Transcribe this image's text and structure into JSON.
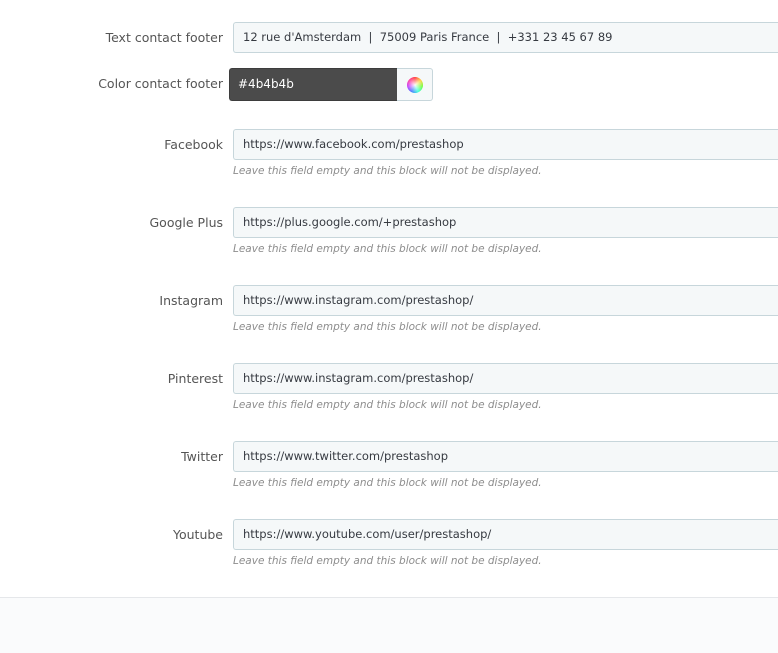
{
  "contact": {
    "text_label": "Text contact footer",
    "text_value": "12 rue d'Amsterdam  |  75009 Paris France  |  +331 23 45 67 89",
    "color_label": "Color contact footer",
    "color_value": "#4b4b4b",
    "color_picker_icon": "color-wheel-icon"
  },
  "social": [
    {
      "label": "Facebook",
      "value": "https://www.facebook.com/prestashop",
      "help": "Leave this field empty and this block will not be displayed."
    },
    {
      "label": "Google Plus",
      "value": "https://plus.google.com/+prestashop",
      "help": "Leave this field empty and this block will not be displayed."
    },
    {
      "label": "Instagram",
      "value": "https://www.instagram.com/prestashop/",
      "help": "Leave this field empty and this block will not be displayed."
    },
    {
      "label": "Pinterest",
      "value": "https://www.instagram.com/prestashop/",
      "help": "Leave this field empty and this block will not be displayed."
    },
    {
      "label": "Twitter",
      "value": "https://www.twitter.com/prestashop",
      "help": "Leave this field empty and this block will not be displayed."
    },
    {
      "label": "Youtube",
      "value": "https://www.youtube.com/user/prestashop/",
      "help": "Leave this field empty and this block will not be displayed."
    }
  ],
  "colors": {
    "input_bg": "#f5f8f9",
    "input_border": "#c7d6db",
    "swatch": "#4b4b4b",
    "help_text": "#8d8d8d"
  }
}
